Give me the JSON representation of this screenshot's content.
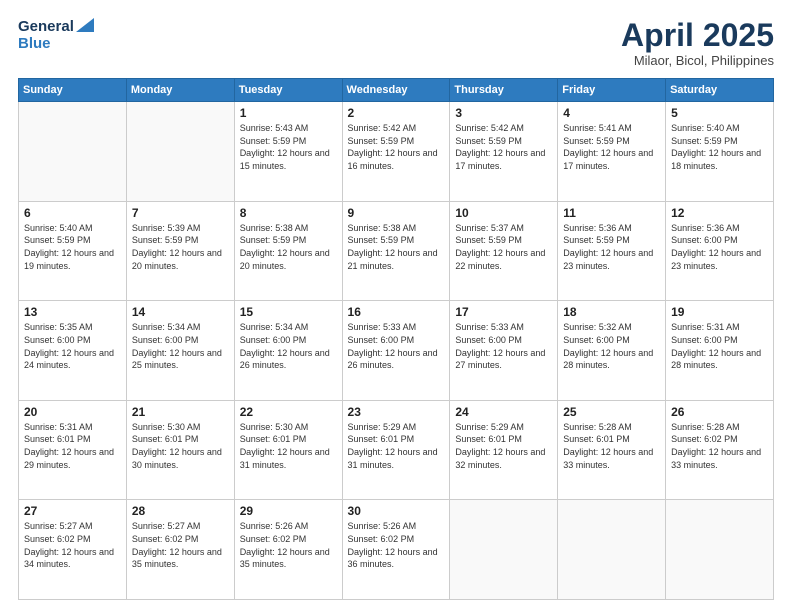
{
  "header": {
    "logo_line1": "General",
    "logo_line2": "Blue",
    "month_title": "April 2025",
    "location": "Milaor, Bicol, Philippines"
  },
  "weekdays": [
    "Sunday",
    "Monday",
    "Tuesday",
    "Wednesday",
    "Thursday",
    "Friday",
    "Saturday"
  ],
  "weeks": [
    [
      {
        "day": "",
        "info": ""
      },
      {
        "day": "",
        "info": ""
      },
      {
        "day": "1",
        "info": "Sunrise: 5:43 AM\nSunset: 5:59 PM\nDaylight: 12 hours and 15 minutes."
      },
      {
        "day": "2",
        "info": "Sunrise: 5:42 AM\nSunset: 5:59 PM\nDaylight: 12 hours and 16 minutes."
      },
      {
        "day": "3",
        "info": "Sunrise: 5:42 AM\nSunset: 5:59 PM\nDaylight: 12 hours and 17 minutes."
      },
      {
        "day": "4",
        "info": "Sunrise: 5:41 AM\nSunset: 5:59 PM\nDaylight: 12 hours and 17 minutes."
      },
      {
        "day": "5",
        "info": "Sunrise: 5:40 AM\nSunset: 5:59 PM\nDaylight: 12 hours and 18 minutes."
      }
    ],
    [
      {
        "day": "6",
        "info": "Sunrise: 5:40 AM\nSunset: 5:59 PM\nDaylight: 12 hours and 19 minutes."
      },
      {
        "day": "7",
        "info": "Sunrise: 5:39 AM\nSunset: 5:59 PM\nDaylight: 12 hours and 20 minutes."
      },
      {
        "day": "8",
        "info": "Sunrise: 5:38 AM\nSunset: 5:59 PM\nDaylight: 12 hours and 20 minutes."
      },
      {
        "day": "9",
        "info": "Sunrise: 5:38 AM\nSunset: 5:59 PM\nDaylight: 12 hours and 21 minutes."
      },
      {
        "day": "10",
        "info": "Sunrise: 5:37 AM\nSunset: 5:59 PM\nDaylight: 12 hours and 22 minutes."
      },
      {
        "day": "11",
        "info": "Sunrise: 5:36 AM\nSunset: 5:59 PM\nDaylight: 12 hours and 23 minutes."
      },
      {
        "day": "12",
        "info": "Sunrise: 5:36 AM\nSunset: 6:00 PM\nDaylight: 12 hours and 23 minutes."
      }
    ],
    [
      {
        "day": "13",
        "info": "Sunrise: 5:35 AM\nSunset: 6:00 PM\nDaylight: 12 hours and 24 minutes."
      },
      {
        "day": "14",
        "info": "Sunrise: 5:34 AM\nSunset: 6:00 PM\nDaylight: 12 hours and 25 minutes."
      },
      {
        "day": "15",
        "info": "Sunrise: 5:34 AM\nSunset: 6:00 PM\nDaylight: 12 hours and 26 minutes."
      },
      {
        "day": "16",
        "info": "Sunrise: 5:33 AM\nSunset: 6:00 PM\nDaylight: 12 hours and 26 minutes."
      },
      {
        "day": "17",
        "info": "Sunrise: 5:33 AM\nSunset: 6:00 PM\nDaylight: 12 hours and 27 minutes."
      },
      {
        "day": "18",
        "info": "Sunrise: 5:32 AM\nSunset: 6:00 PM\nDaylight: 12 hours and 28 minutes."
      },
      {
        "day": "19",
        "info": "Sunrise: 5:31 AM\nSunset: 6:00 PM\nDaylight: 12 hours and 28 minutes."
      }
    ],
    [
      {
        "day": "20",
        "info": "Sunrise: 5:31 AM\nSunset: 6:01 PM\nDaylight: 12 hours and 29 minutes."
      },
      {
        "day": "21",
        "info": "Sunrise: 5:30 AM\nSunset: 6:01 PM\nDaylight: 12 hours and 30 minutes."
      },
      {
        "day": "22",
        "info": "Sunrise: 5:30 AM\nSunset: 6:01 PM\nDaylight: 12 hours and 31 minutes."
      },
      {
        "day": "23",
        "info": "Sunrise: 5:29 AM\nSunset: 6:01 PM\nDaylight: 12 hours and 31 minutes."
      },
      {
        "day": "24",
        "info": "Sunrise: 5:29 AM\nSunset: 6:01 PM\nDaylight: 12 hours and 32 minutes."
      },
      {
        "day": "25",
        "info": "Sunrise: 5:28 AM\nSunset: 6:01 PM\nDaylight: 12 hours and 33 minutes."
      },
      {
        "day": "26",
        "info": "Sunrise: 5:28 AM\nSunset: 6:02 PM\nDaylight: 12 hours and 33 minutes."
      }
    ],
    [
      {
        "day": "27",
        "info": "Sunrise: 5:27 AM\nSunset: 6:02 PM\nDaylight: 12 hours and 34 minutes."
      },
      {
        "day": "28",
        "info": "Sunrise: 5:27 AM\nSunset: 6:02 PM\nDaylight: 12 hours and 35 minutes."
      },
      {
        "day": "29",
        "info": "Sunrise: 5:26 AM\nSunset: 6:02 PM\nDaylight: 12 hours and 35 minutes."
      },
      {
        "day": "30",
        "info": "Sunrise: 5:26 AM\nSunset: 6:02 PM\nDaylight: 12 hours and 36 minutes."
      },
      {
        "day": "",
        "info": ""
      },
      {
        "day": "",
        "info": ""
      },
      {
        "day": "",
        "info": ""
      }
    ]
  ]
}
